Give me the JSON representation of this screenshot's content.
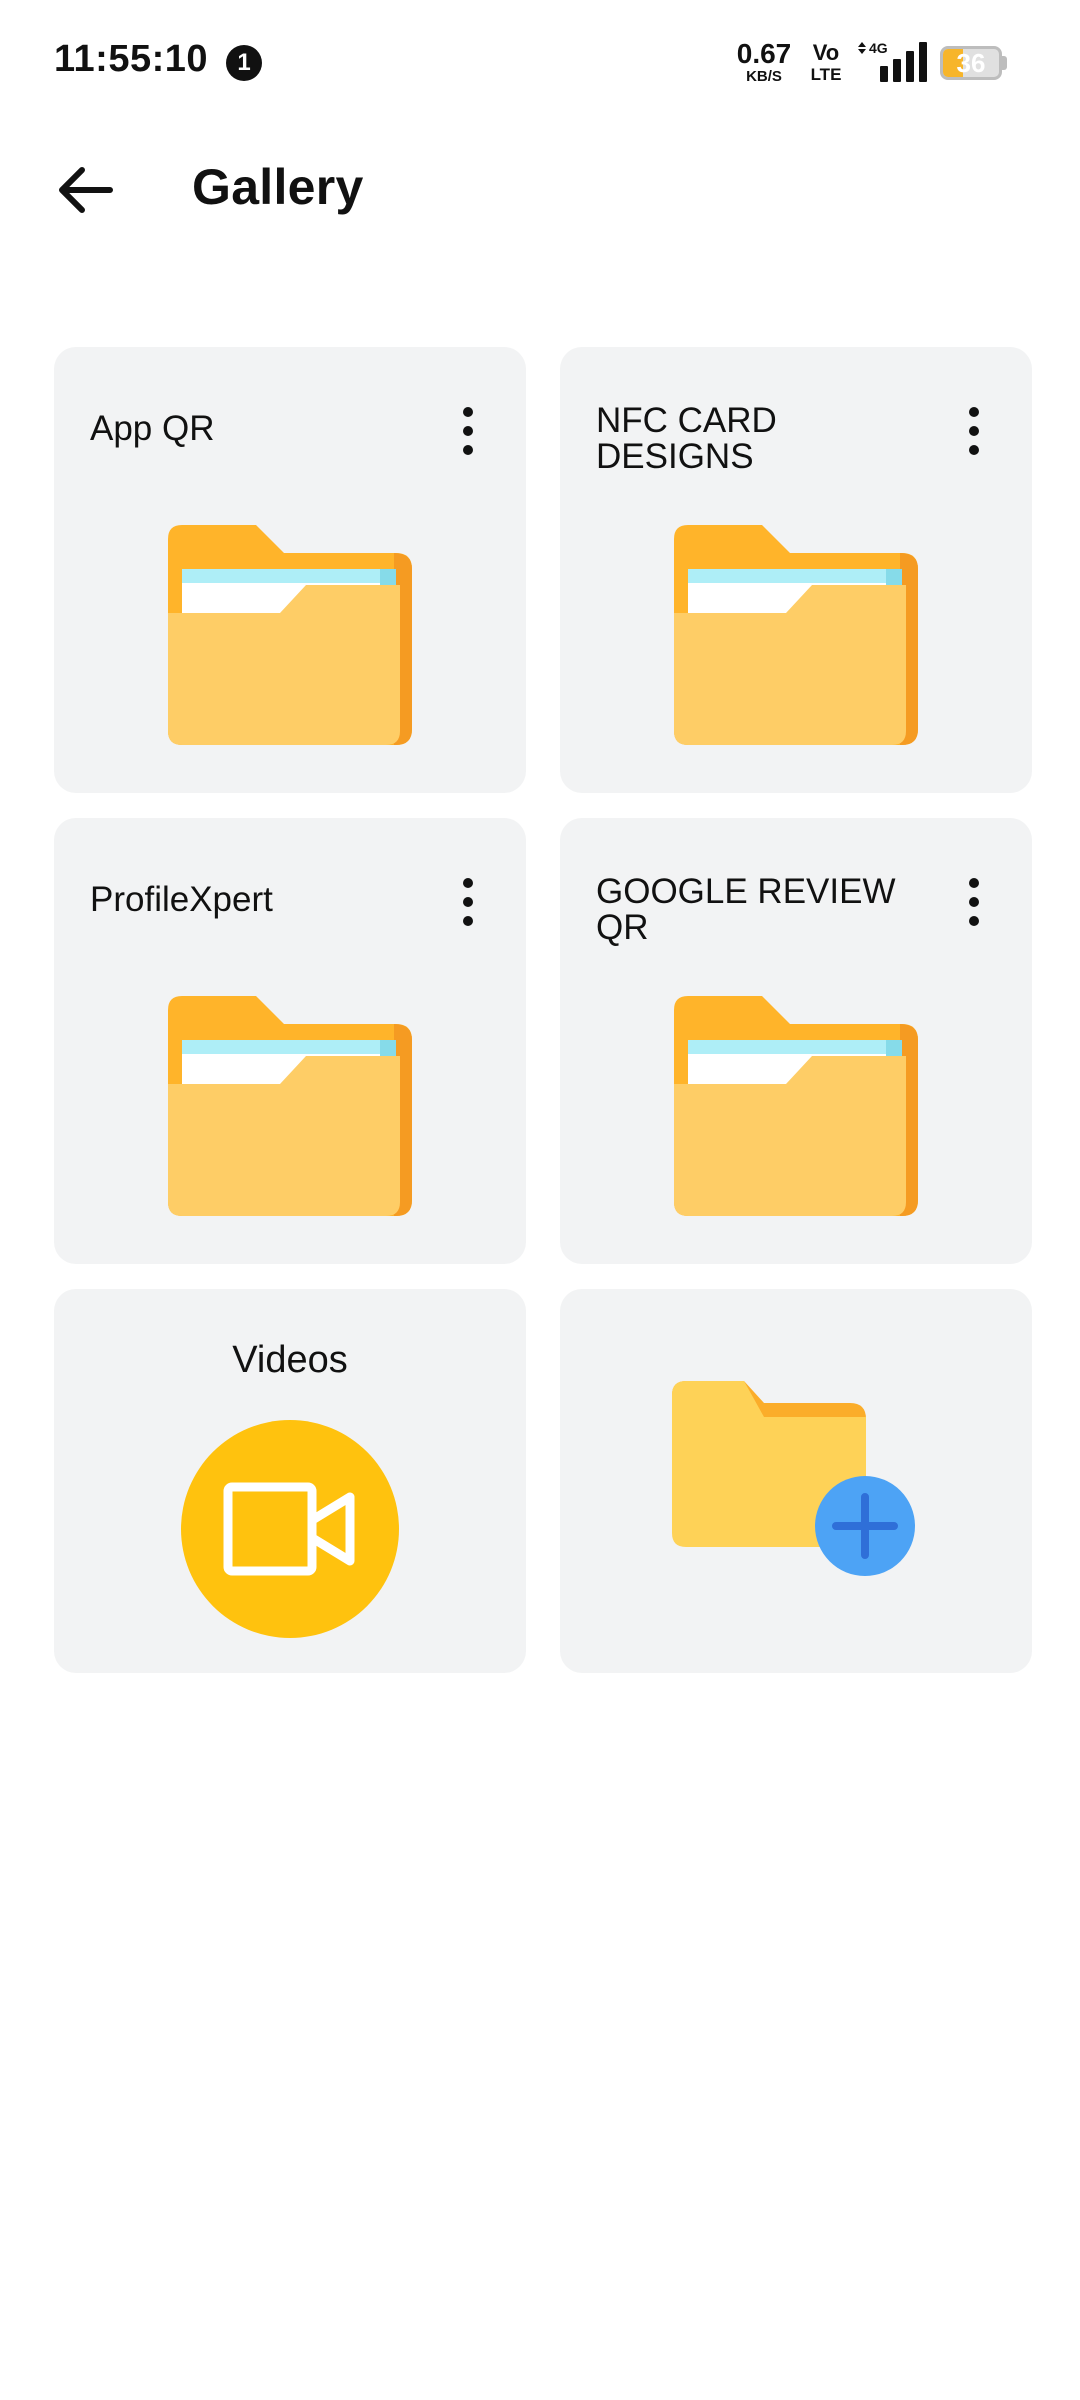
{
  "status_bar": {
    "time": "11:55:10",
    "notification_count": "1",
    "net_speed_value": "0.67",
    "net_speed_unit": "KB/S",
    "volte_top": "Vo",
    "volte_bottom": "LTE",
    "network_type": "4G",
    "battery_level": "36",
    "battery_color": "#f7b52a"
  },
  "header": {
    "back_icon": "arrow-left-icon",
    "title": "Gallery"
  },
  "folders": [
    {
      "name": "App QR",
      "icon": "folder-icon",
      "menu_icon": "more-vertical-icon"
    },
    {
      "name": "NFC CARD DESIGNS",
      "icon": "folder-icon",
      "menu_icon": "more-vertical-icon"
    },
    {
      "name": "ProfileXpert",
      "icon": "folder-icon",
      "menu_icon": "more-vertical-icon"
    },
    {
      "name": "GOOGLE REVIEW QR",
      "icon": "folder-icon",
      "menu_icon": "more-vertical-icon"
    }
  ],
  "videos": {
    "label": "Videos",
    "icon": "video-camera-icon",
    "color": "#ffc20e"
  },
  "add_folder": {
    "icon": "add-folder-icon",
    "plus_color": "#4da3f5"
  }
}
